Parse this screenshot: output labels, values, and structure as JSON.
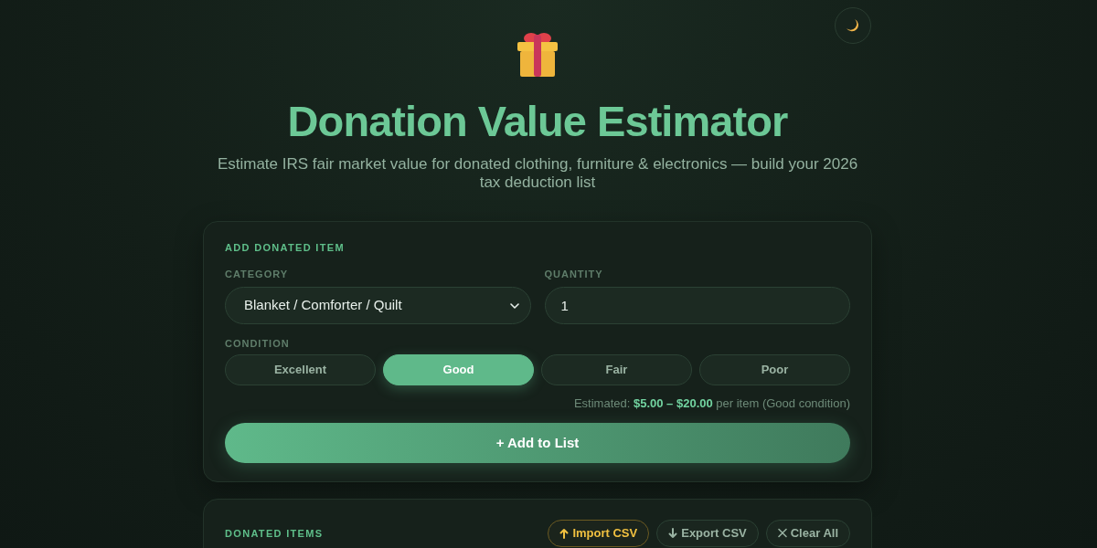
{
  "header": {
    "title": "Donation Value Estimator",
    "subtitle": "Estimate IRS fair market value for donated clothing, furniture & electronics — build your 2026 tax deduction list"
  },
  "add_item": {
    "heading": "ADD DONATED ITEM",
    "category": {
      "label": "CATEGORY",
      "value": "Blanket / Comforter / Quilt"
    },
    "quantity": {
      "label": "QUANTITY",
      "value": "1"
    },
    "condition": {
      "label": "CONDITION",
      "options": [
        {
          "label": "Excellent",
          "selected": false
        },
        {
          "label": "Good",
          "selected": true
        },
        {
          "label": "Fair",
          "selected": false
        },
        {
          "label": "Poor",
          "selected": false
        }
      ]
    },
    "estimate": "Estimated: **$5.00 – $20.00** per item (Good condition)",
    "add_button": "+ Add to List"
  },
  "donated_items": {
    "heading": "DONATED ITEMS",
    "actions": [
      {
        "kind": "import",
        "label": "Import CSV"
      },
      {
        "kind": "export",
        "label": "Export CSV"
      },
      {
        "kind": "clear",
        "label": "Clear All"
      }
    ]
  }
}
